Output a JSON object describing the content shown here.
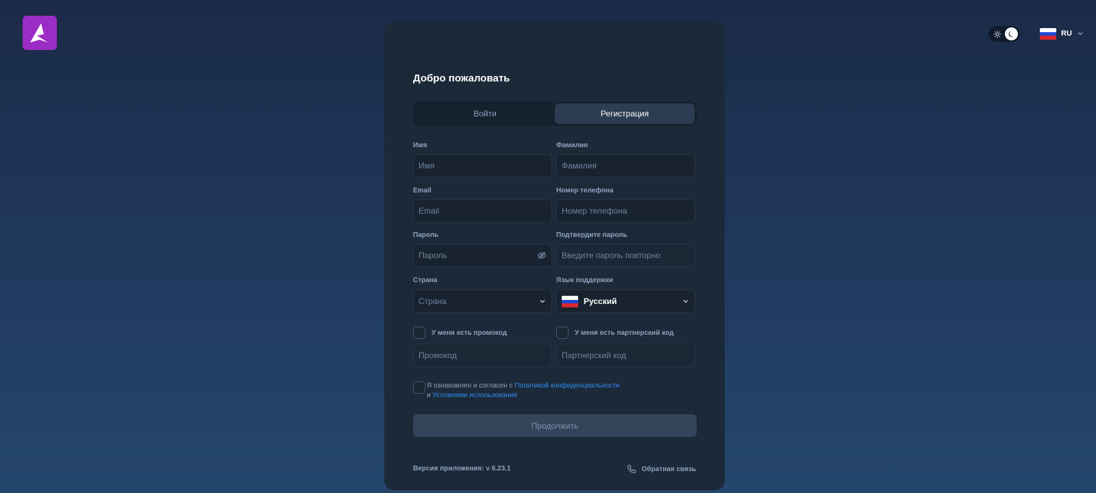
{
  "header": {
    "logo_icon": "a-arrow-logo",
    "theme_toggle": {
      "light_icon": "sun-icon",
      "dark_icon": "moon-icon",
      "active": "dark"
    },
    "language": {
      "code": "RU",
      "flag": "russia-flag-icon"
    }
  },
  "card": {
    "title": "Добро пожаловать",
    "tabs": [
      {
        "label": "Войти",
        "active": false
      },
      {
        "label": "Регистрация",
        "active": true
      }
    ],
    "fields": {
      "first_name": {
        "label": "Имя",
        "placeholder": "Имя",
        "value": ""
      },
      "last_name": {
        "label": "Фамилия",
        "placeholder": "Фамилия",
        "value": ""
      },
      "email": {
        "label": "Email",
        "placeholder": "Email",
        "value": ""
      },
      "phone": {
        "label": "Номер телефона",
        "placeholder": "Номер телефона",
        "value": ""
      },
      "password": {
        "label": "Пароль",
        "placeholder": "Пароль",
        "value": "",
        "icon": "eye-off-icon"
      },
      "confirm_password": {
        "label": "Подтвердите пароль",
        "placeholder": "Введите пароль повторно",
        "value": ""
      },
      "country": {
        "label": "Страна",
        "placeholder": "Страна",
        "value": ""
      },
      "support_language": {
        "label": "Язык поддержки",
        "value": "Русский",
        "flag": "russia-flag-icon"
      }
    },
    "promo": {
      "checkbox_label": "У меня есть промокод",
      "placeholder": "Промокод",
      "checked": false
    },
    "partner": {
      "checkbox_label": "У меня есть партнерский код",
      "placeholder": "Партнерский код",
      "checked": false
    },
    "agreement": {
      "checked": false,
      "text_before": "Я ознакомлен и согласен с ",
      "privacy_link": "Политикой конфиденциальности",
      "text_middle": "и ",
      "terms_link": "Условиями использования"
    },
    "continue_label": "Продолжить",
    "footer": {
      "version": "Версия приложения: v 6.23.1",
      "feedback_label": "Обратная связь",
      "feedback_icon": "phone-icon"
    }
  },
  "colors": {
    "accent": "#2f8cf2",
    "logo_bg": "#9b2cc4",
    "card_bg": "#1c2938"
  }
}
